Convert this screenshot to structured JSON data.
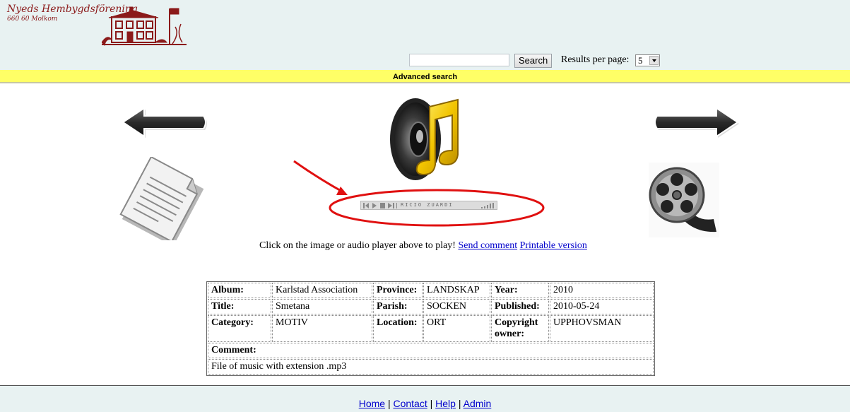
{
  "header": {
    "org_name": "Nyeds Hembygdsförening",
    "org_address": "660 60 Molkom"
  },
  "search": {
    "input_value": "",
    "input_placeholder": "",
    "button_label": "Search",
    "rpp_label": "Results per page:",
    "rpp_value": "5",
    "advanced_label": "Advanced search"
  },
  "media": {
    "prev_icon": "left-arrow-icon",
    "next_icon": "right-arrow-icon",
    "main_icon": "music-speaker-icon",
    "document_icon": "document-icon",
    "video_icon": "film-reel-icon",
    "player_text": "RICIO ZUARDI",
    "annotation_color": "#e01010"
  },
  "caption": {
    "text": "Click on the image or audio player above to play! ",
    "send_comment": "Send comment",
    "printable": "Printable version"
  },
  "details": {
    "album_label": "Album:",
    "album": "Karlstad Association",
    "province_label": "Province:",
    "province": "LANDSKAP",
    "year_label": "Year:",
    "year": "2010",
    "title_label": "Title:",
    "title": "Smetana",
    "parish_label": "Parish:",
    "parish": "SOCKEN",
    "published_label": "Published:",
    "published": "2010-05-24",
    "category_label": "Category:",
    "category": "MOTIV",
    "location_label": "Location:",
    "location": "ORT",
    "copyright_label": "Copyright owner:",
    "copyright": "UPPHOVSMAN",
    "comment_label": "Comment:",
    "comment": "File of music with extension .mp3"
  },
  "footer": {
    "home": "Home",
    "contact": "Contact",
    "help": "Help",
    "admin": "Admin",
    "sep": " | "
  }
}
